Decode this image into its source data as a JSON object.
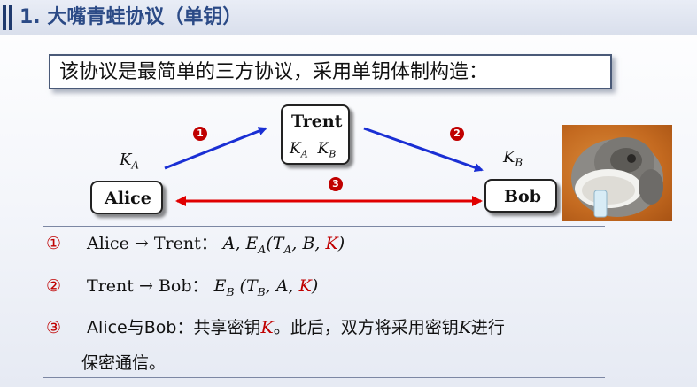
{
  "header": {
    "title": "1. 大嘴青蛙协议（单钥）"
  },
  "intro": {
    "text": "该协议是最简单的三方协议，采用单钥体制构造："
  },
  "diagram": {
    "nodes": {
      "trent": {
        "name": "Trent",
        "keys": [
          "K_A",
          "K_B"
        ]
      },
      "alice": {
        "name": "Alice",
        "key": "K_A"
      },
      "bob": {
        "name": "Bob",
        "key": "K_B"
      }
    },
    "markers": [
      "1",
      "2",
      "3"
    ],
    "colors": {
      "blue_arrow": "#1a2fd4",
      "red_arrow": "#e00000",
      "marker": "#c00000"
    }
  },
  "steps": [
    {
      "num": "①",
      "text": "Alice → Trent：A, E_A(T_A, B, K)"
    },
    {
      "num": "②",
      "text": "Trent → Bob：E_B (T_B, A, K)"
    },
    {
      "num": "③",
      "text": "Alice与Bob：共享密钥K。此后，双方将采用密钥K进行保密通信。"
    }
  ],
  "labels": {
    "step1_from": "Alice",
    "step1_to": "Trent：",
    "step2_from": "Trent",
    "step2_to": "Bob：",
    "step3_a": "Alice与Bob：",
    "step3_b": "共享密钥",
    "step3_c": "。此后，双方将采用密钥",
    "step3_d": "进行",
    "step3_e": "保密通信。",
    "arrow": "→"
  }
}
